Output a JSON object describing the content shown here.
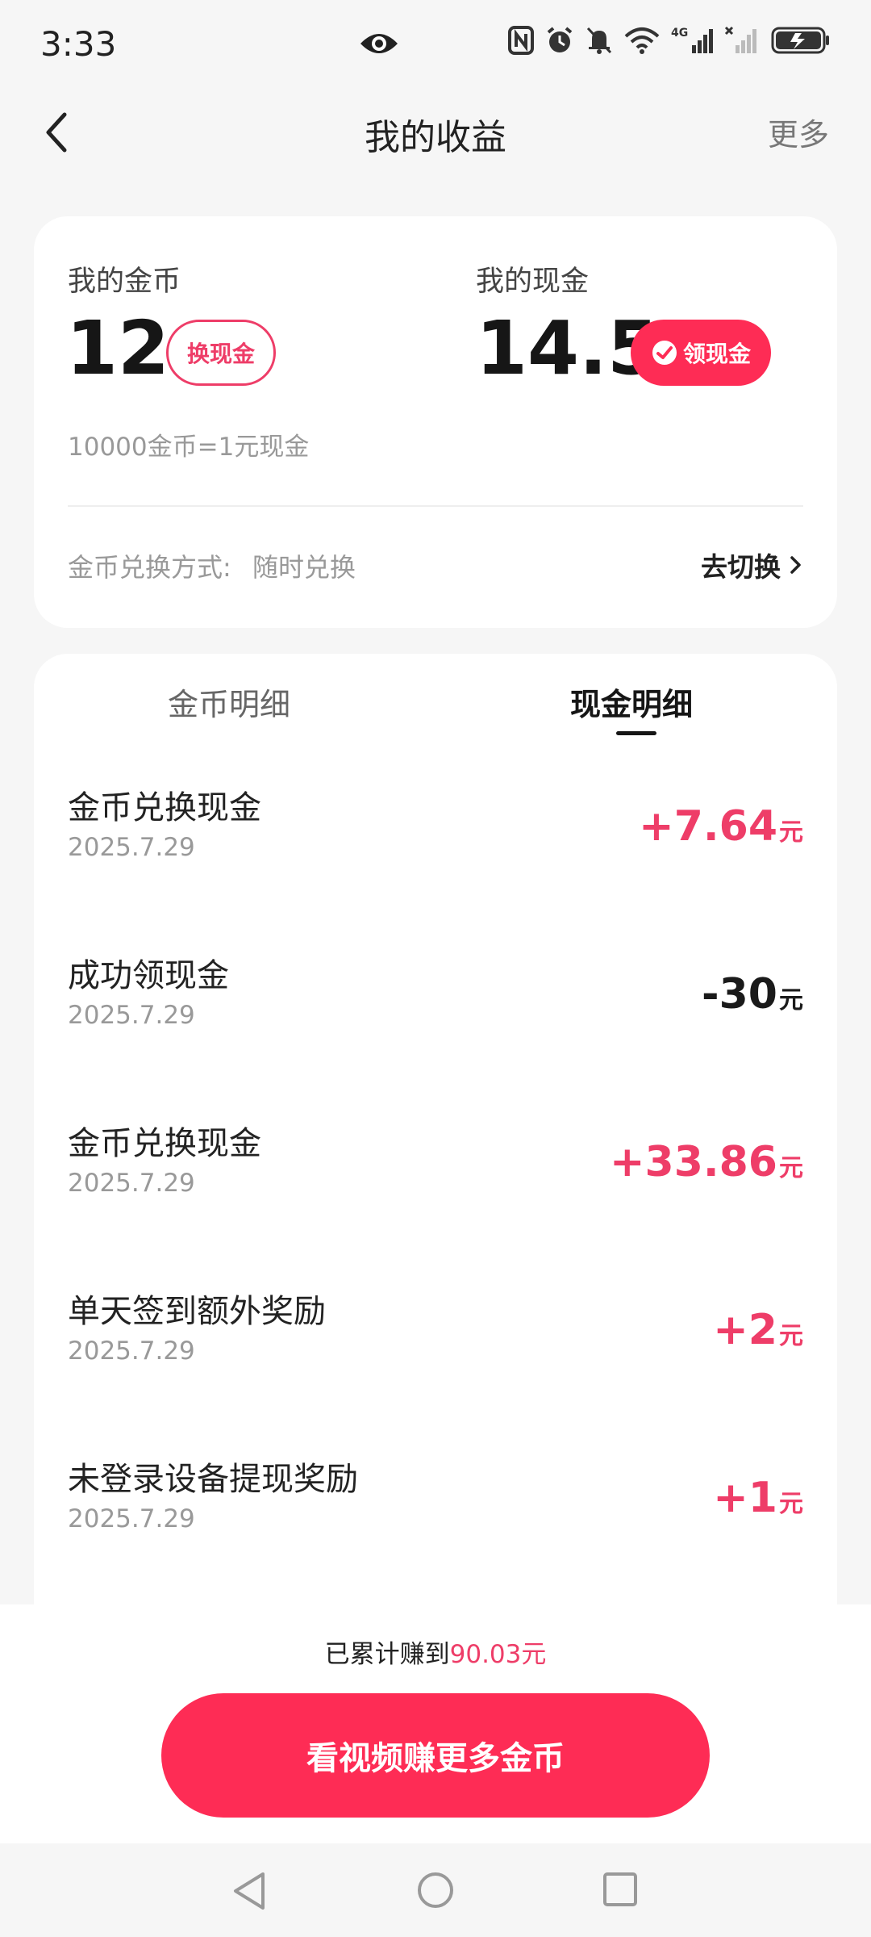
{
  "status_bar": {
    "time": "3:33",
    "network_label": "4G"
  },
  "nav": {
    "title": "我的收益",
    "more_label": "更多"
  },
  "balance": {
    "coin_label": "我的金币",
    "coin_value": "12",
    "exchange_button": "换现金",
    "cash_label": "我的现金",
    "cash_value": "14.5",
    "withdraw_button": "领现金",
    "rate_text": "10000金币=1元现金",
    "exchange_mode_label": "金币兑换方式:",
    "exchange_mode_value": "随时兑换",
    "switch_label": "去切换"
  },
  "tabs": {
    "coin_detail": "金币明细",
    "cash_detail": "现金明细",
    "active": "cash_detail"
  },
  "records": [
    {
      "title": "金币兑换现金",
      "date": "2025.7.29",
      "amount": "+7.64",
      "unit": "元",
      "sign": "plus"
    },
    {
      "title": "成功领现金",
      "date": "2025.7.29",
      "amount": "-30",
      "unit": "元",
      "sign": "minus"
    },
    {
      "title": "金币兑换现金",
      "date": "2025.7.29",
      "amount": "+33.86",
      "unit": "元",
      "sign": "plus"
    },
    {
      "title": "单天签到额外奖励",
      "date": "2025.7.29",
      "amount": "+2",
      "unit": "元",
      "sign": "plus"
    },
    {
      "title": "未登录设备提现奖励",
      "date": "2025.7.29",
      "amount": "+1",
      "unit": "元",
      "sign": "plus"
    }
  ],
  "footer": {
    "total_prefix": "已累计赚到",
    "total_amount": "90.03元",
    "cta_label": "看视频赚更多金币"
  },
  "colors": {
    "accent": "#fe2c55",
    "accent_text": "#ee3d68",
    "background": "#f6f6f6"
  },
  "icons": [
    "eye-icon",
    "nfc-icon",
    "alarm-icon",
    "mute-bell-icon",
    "wifi-icon",
    "signal-icon",
    "battery-icon",
    "back-icon",
    "wechat-icon",
    "chevron-right-icon"
  ]
}
